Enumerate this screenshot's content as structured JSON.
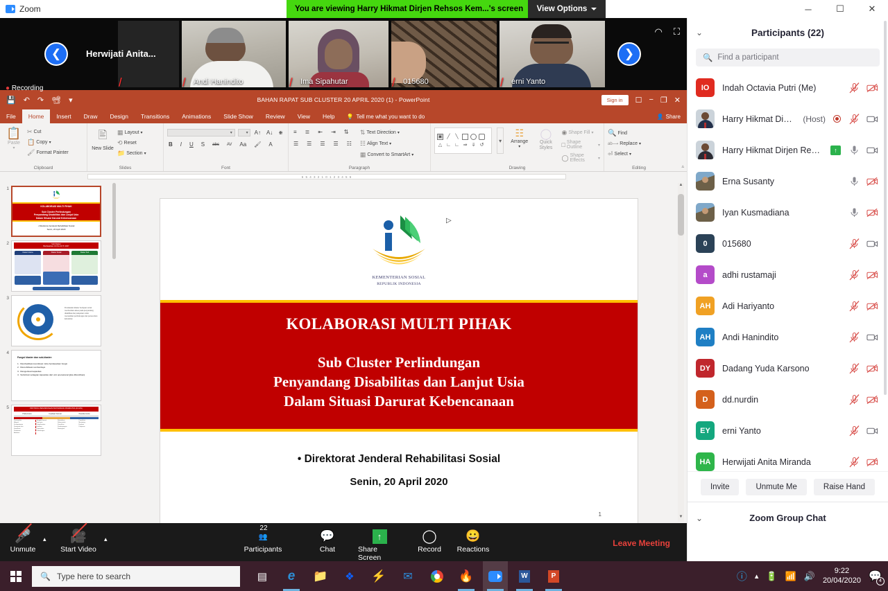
{
  "zoom_app": {
    "name": "Zoom",
    "viewing_banner": "You are viewing Harry Hikmat Dirjen Rehsos Kem...'s screen",
    "view_options": "View Options",
    "window_controls": {
      "minimize": "─",
      "maximize": "☐",
      "close": "✕"
    },
    "filmstrip": {
      "prev": "❮",
      "next": "❯",
      "tiles": [
        {
          "name": "Herwijati Anita...",
          "muted": true,
          "video": false
        },
        {
          "name": "Andi Hanindito",
          "muted": true,
          "video": true
        },
        {
          "name": "Ima Sipahutar",
          "muted": true,
          "video": true
        },
        {
          "name": "015680",
          "muted": true,
          "video": true
        },
        {
          "name": "erni Yanto",
          "muted": true,
          "video": true
        }
      ],
      "pip_icon": "picture-in-picture-icon",
      "fullscreen_icon": "fullscreen-icon"
    },
    "toolbar": {
      "unmute": "Unmute",
      "start_video": "Start Video",
      "participants": "Participants",
      "participants_count": "22",
      "chat": "Chat",
      "share_screen": "Share Screen",
      "record": "Record",
      "reactions": "Reactions",
      "leave_meeting": "Leave Meeting"
    }
  },
  "panel": {
    "title": "Participants (22)",
    "search_placeholder": "Find a participant",
    "buttons": {
      "invite": "Invite",
      "unmute_me": "Unmute Me",
      "raise_hand": "Raise Hand"
    },
    "chat_title": "Zoom Group Chat",
    "participants": [
      {
        "initials": "IO",
        "color": "#e02b20",
        "name": "Indah Octavia Putri (Me)",
        "tag": "",
        "avatar": "initials",
        "mic": "muted",
        "cam": "off",
        "host": false,
        "recording": false,
        "sharing": false
      },
      {
        "initials": "",
        "color": "#cbd3da",
        "name": "Harry Hikmat Dirjen ...",
        "tag": "(Host)",
        "avatar": "photo-suit",
        "mic": "muted",
        "cam": "on",
        "host": true,
        "recording": true,
        "sharing": false
      },
      {
        "initials": "",
        "color": "#cbd3da",
        "name": "Harry Hikmat Dirjen Rehsos...",
        "tag": "",
        "avatar": "photo-suit2",
        "mic": "on",
        "cam": "on",
        "host": false,
        "recording": false,
        "sharing": true
      },
      {
        "initials": "",
        "color": "#9a8f7a",
        "name": "Erna Susanty",
        "tag": "",
        "avatar": "photo-outdoor",
        "mic": "on",
        "cam": "off",
        "host": false,
        "recording": false,
        "sharing": false
      },
      {
        "initials": "",
        "color": "#9a8f7a",
        "name": "Iyan Kusmadiana",
        "tag": "",
        "avatar": "photo-outdoor",
        "mic": "on",
        "cam": "off",
        "host": false,
        "recording": false,
        "sharing": false
      },
      {
        "initials": "0",
        "color": "#2b4257",
        "name": "015680",
        "tag": "",
        "avatar": "initials",
        "mic": "muted",
        "cam": "on",
        "host": false,
        "recording": false,
        "sharing": false
      },
      {
        "initials": "a",
        "color": "#b44bc9",
        "name": "adhi rustamaji",
        "tag": "",
        "avatar": "initials",
        "mic": "muted",
        "cam": "off",
        "host": false,
        "recording": false,
        "sharing": false
      },
      {
        "initials": "AH",
        "color": "#f0a124",
        "name": "Adi Hariyanto",
        "tag": "",
        "avatar": "initials",
        "mic": "muted",
        "cam": "off",
        "host": false,
        "recording": false,
        "sharing": false
      },
      {
        "initials": "AH",
        "color": "#1f7fc4",
        "name": "Andi Hanindito",
        "tag": "",
        "avatar": "initials",
        "mic": "muted",
        "cam": "on",
        "host": false,
        "recording": false,
        "sharing": false
      },
      {
        "initials": "DY",
        "color": "#c0272d",
        "name": "Dadang Yuda Karsono",
        "tag": "",
        "avatar": "initials",
        "mic": "muted",
        "cam": "off",
        "host": false,
        "recording": false,
        "sharing": false
      },
      {
        "initials": "D",
        "color": "#d4601c",
        "name": "dd.nurdin",
        "tag": "",
        "avatar": "initials",
        "mic": "muted",
        "cam": "off",
        "host": false,
        "recording": false,
        "sharing": false
      },
      {
        "initials": "EY",
        "color": "#14a77e",
        "name": "erni Yanto",
        "tag": "",
        "avatar": "initials",
        "mic": "muted",
        "cam": "on",
        "host": false,
        "recording": false,
        "sharing": false
      },
      {
        "initials": "HA",
        "color": "#2eb54a",
        "name": "Herwijati Anita Miranda",
        "tag": "",
        "avatar": "initials",
        "mic": "muted",
        "cam": "off",
        "host": false,
        "recording": false,
        "sharing": false
      }
    ]
  },
  "powerpoint": {
    "document_title": "BAHAN RAPAT SUB CLUSTER 20 APRIL 2020 (1)  -  PowerPoint",
    "sign_in": "Sign in",
    "share": "Share",
    "tell_me": "Tell me what you want to do",
    "recording_label": "Recording",
    "tabs": [
      "File",
      "Home",
      "Insert",
      "Draw",
      "Design",
      "Transitions",
      "Animations",
      "Slide Show",
      "Review",
      "View",
      "Help"
    ],
    "active_tab": "Home",
    "ribbon": {
      "groups": [
        "Clipboard",
        "Slides",
        "Font",
        "Paragraph",
        "Drawing",
        "Editing"
      ],
      "clipboard": {
        "paste": "Paste",
        "cut": "Cut",
        "copy": "Copy",
        "format_painter": "Format Painter"
      },
      "slides": {
        "new_slide": "New Slide",
        "layout": "Layout",
        "reset": "Reset",
        "section": "Section"
      },
      "font": {
        "font_name": "",
        "font_size": "",
        "bold": "B",
        "italic": "I",
        "underline": "U",
        "shadow": "S",
        "strikethrough": "abc",
        "spacing": "AV",
        "case": "Aa"
      },
      "paragraph": {
        "text_direction": "Text Direction",
        "align_text": "Align Text",
        "convert_smartart": "Convert to SmartArt"
      },
      "drawing": {
        "arrange": "Arrange",
        "quick_styles": "Quick Styles",
        "shape_fill": "Shape Fill",
        "shape_outline": "Shape Outline",
        "shape_effects": "Shape Effects"
      },
      "editing": {
        "find": "Find",
        "replace": "Replace",
        "select": "Select"
      }
    },
    "ruler_marks": "6    5    4    3    2    1    0    1    2    3    4    5    6",
    "thumbnails": [
      {
        "number": "1",
        "selected": true
      },
      {
        "number": "2",
        "selected": false
      },
      {
        "number": "3",
        "selected": false
      },
      {
        "number": "4",
        "selected": false
      },
      {
        "number": "5",
        "selected": false
      }
    ],
    "thumb_texts": {
      "s1_title": "KOLABORASI MULTI PIHAK",
      "s1_sub": "Sub Cluster Perlindungan<br>Penyandang Disabilitas dan Lanjut Usia<br>Dalam Situasi Darurat Kebencanaan",
      "s1_foot": "• Direktorat Jenderal Rehabilitasi Sosial<br>Senin, 20 April 2020",
      "s2_hdr": "Sub Klaster\nBerdasarkan UU No 24 Tahun 2007 Tentang Penanggulangan Bencana",
      "s2_c1": "Klaster Utama",
      "s2_c2": "Klaster Sosial",
      "s2_c3": "Klaster Sub Utama",
      "s3_text": "Pendekatan klaster bertujuan untuk memberikan akses pada penyandang disabilitas dan pelayanan untuk memastikan perlindungan dan pemenuhan kebutuhan",
      "s4_head": "Fungsi klaster dan sub-klaster:",
      "s4_list": "1.  Memfasilitasi koordinasi mitra berdasarkan fungsi<br>2.  Memobilisasi sumberdaya<br>3.  Mengerkuat kapasitas<br>4.  Substitusi sebagian kapasitas dari unit operasional (jika dibutuhkan)",
      "s5_hdr": "PROTOKOL PERLINDUNGAN PENYANDANG DISABILITAS (ACUAN)"
    },
    "slide": {
      "org_line1": "KEMENTERIAN SOSIAL",
      "org_line2": "REPUBLIK INDONESIA",
      "title": "KOLABORASI MULTI PIHAK",
      "subtitle_l1": "Sub Cluster Perlindungan",
      "subtitle_l2": "Penyandang Disabilitas dan Lanjut Usia",
      "subtitle_l3": "Dalam Situasi Darurat Kebencanaan",
      "footer_1": "• Direktorat  Jenderal  Rehabilitasi  Sosial",
      "footer_2": "Senin, 20 April 2020",
      "page_number": "1",
      "band_color": "#c00000",
      "band_border_color": "#ffc000"
    }
  },
  "taskbar": {
    "search_placeholder": "Type here to search",
    "apps": [
      "task-view",
      "edge",
      "file-explorer",
      "dropbox",
      "shareit",
      "mail",
      "chrome",
      "firefox",
      "zoom",
      "word",
      "powerpoint"
    ],
    "time": "9:22",
    "date": "20/04/2020",
    "notification_count": "4"
  }
}
